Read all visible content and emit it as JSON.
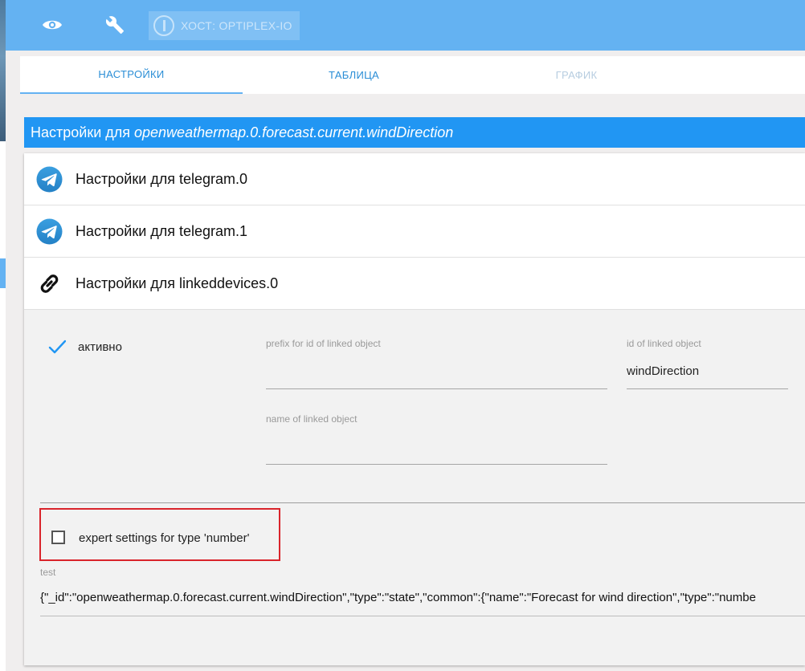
{
  "toolbar": {
    "host_label": "ХОСТ: OPTIPLEX-IO",
    "icons": [
      "eye-icon",
      "wrench-icon",
      "iobroker-logo-icon"
    ],
    "color": "#64b2f2"
  },
  "tabs": [
    {
      "label": "НАСТРОЙКИ",
      "active": true
    },
    {
      "label": "ТАБЛИЦА",
      "active": false
    },
    {
      "label": "ГРАФИК",
      "active": false,
      "disabled": true
    }
  ],
  "header": {
    "prefix": "Настройки для",
    "object_id": "openweathermap.0.forecast.current.windDirection",
    "color": "#2196f3"
  },
  "sections": [
    {
      "label": "Настройки для telegram.0",
      "icon": "telegram-icon"
    },
    {
      "label": "Настройки для telegram.1",
      "icon": "telegram-icon"
    },
    {
      "label": "Настройки для linkeddevices.0",
      "icon": "link-icon"
    }
  ],
  "linkeddevices": {
    "active_label": "активно",
    "active_checked": true,
    "prefix_label": "prefix for id of linked object",
    "prefix_value": "",
    "id_label": "id of linked object",
    "id_value": "windDirection",
    "name_label": "name of linked object",
    "name_value": "",
    "expert_label": "expert settings for type 'number'",
    "expert_checked": false,
    "test_label": "test",
    "test_value": "{\"_id\":\"openweathermap.0.forecast.current.windDirection\",\"type\":\"state\",\"common\":{\"name\":\"Forecast for wind direction\",\"type\":\"numbe"
  }
}
